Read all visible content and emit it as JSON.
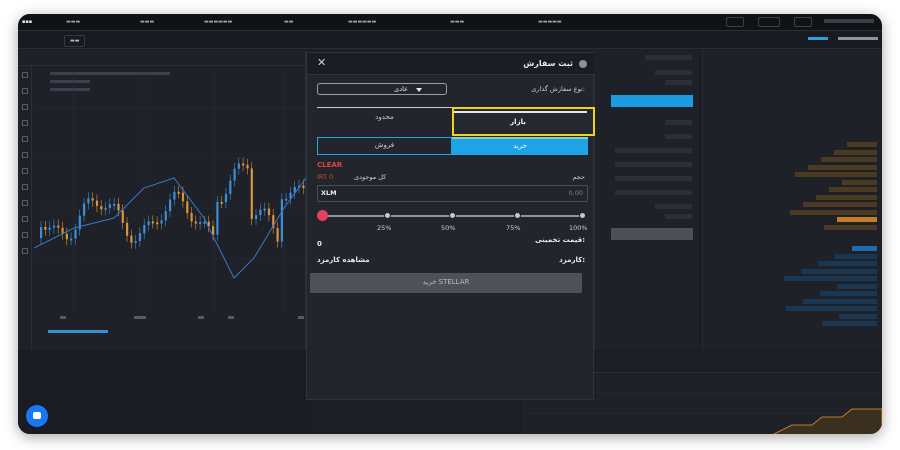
{
  "colors": {
    "accent_blue": "#1ea3e6",
    "highlight_yellow": "#f2d21a",
    "danger_red": "#e0443a",
    "slider_thumb": "#e5405e",
    "bid_orange": "#c47c2a",
    "ask_blue": "#1b6fb0"
  },
  "modal": {
    "title": "ثبت سفارش",
    "close_icon": "close-icon",
    "order_type_label": "نوع سفارش گذاری:",
    "order_type_value": "عادی",
    "tabs": {
      "market": "بازار",
      "limit": "محدود"
    },
    "sides": {
      "buy": "خرید",
      "sell": "فروش"
    },
    "clear": "CLEAR",
    "balance_label": "کل موجودی",
    "balance_value": "IRT 0",
    "volume_label": "حجم",
    "volume_unit": "XLM",
    "volume_placeholder": "0.00",
    "slider_marks": [
      "25%",
      "50%",
      "75%",
      "100%"
    ],
    "slider_value_percent": 0,
    "estimated_price_label": "قیمت تخمینی:",
    "estimated_price_value": "0",
    "fee_label": "کارمزد:",
    "fee_link": "مشاهده کارمزد",
    "submit_label": "خرید STELLAR"
  }
}
